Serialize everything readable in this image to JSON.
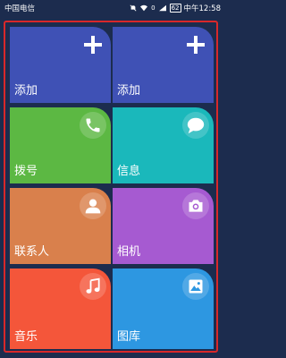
{
  "status_bar": {
    "carrier": "中国电信",
    "speed": "0",
    "battery": "62",
    "time": "中午12:58"
  },
  "tiles": [
    {
      "label": "添加",
      "color": "#3f51b5",
      "icon": "plus-icon"
    },
    {
      "label": "添加",
      "color": "#3f51b5",
      "icon": "plus-icon"
    },
    {
      "label": "拨号",
      "color": "#5cb843",
      "icon": "phone-icon"
    },
    {
      "label": "信息",
      "color": "#1ab8bb",
      "icon": "message-icon"
    },
    {
      "label": "联系人",
      "color": "#d9804c",
      "icon": "contact-icon"
    },
    {
      "label": "相机",
      "color": "#a65ad1",
      "icon": "camera-icon"
    },
    {
      "label": "音乐",
      "color": "#f4563a",
      "icon": "music-note-icon"
    },
    {
      "label": "图库",
      "color": "#2d97e1",
      "icon": "gallery-icon"
    }
  ]
}
